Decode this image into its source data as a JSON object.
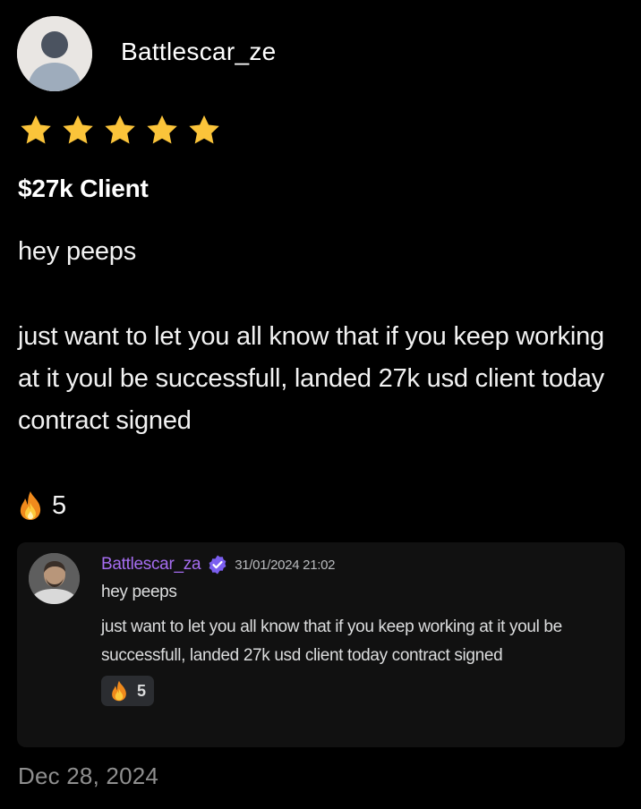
{
  "review": {
    "username": "Battlescar_ze",
    "rating": 5,
    "rating_max": 5,
    "star_color": "#fbc43a",
    "title": "$27k Client",
    "body": {
      "greeting": "hey peeps",
      "message": "just want to let you all know that if you keep working at it youl be successfull, landed 27k usd client today contract signed"
    },
    "reaction": {
      "icon": "fire-icon",
      "count": "5"
    },
    "date": "Dec 28, 2024"
  },
  "embed": {
    "author": "Battlescar_za",
    "author_color": "#a56df0",
    "verified_icon": "verified-badge-icon",
    "timestamp": "31/01/2024 21:02",
    "greeting": "hey peeps",
    "message": "just want to let you all know that if you keep working at it youl be successfull, landed 27k usd client today contract signed",
    "reaction": {
      "icon": "fire-icon",
      "count": "5"
    }
  }
}
